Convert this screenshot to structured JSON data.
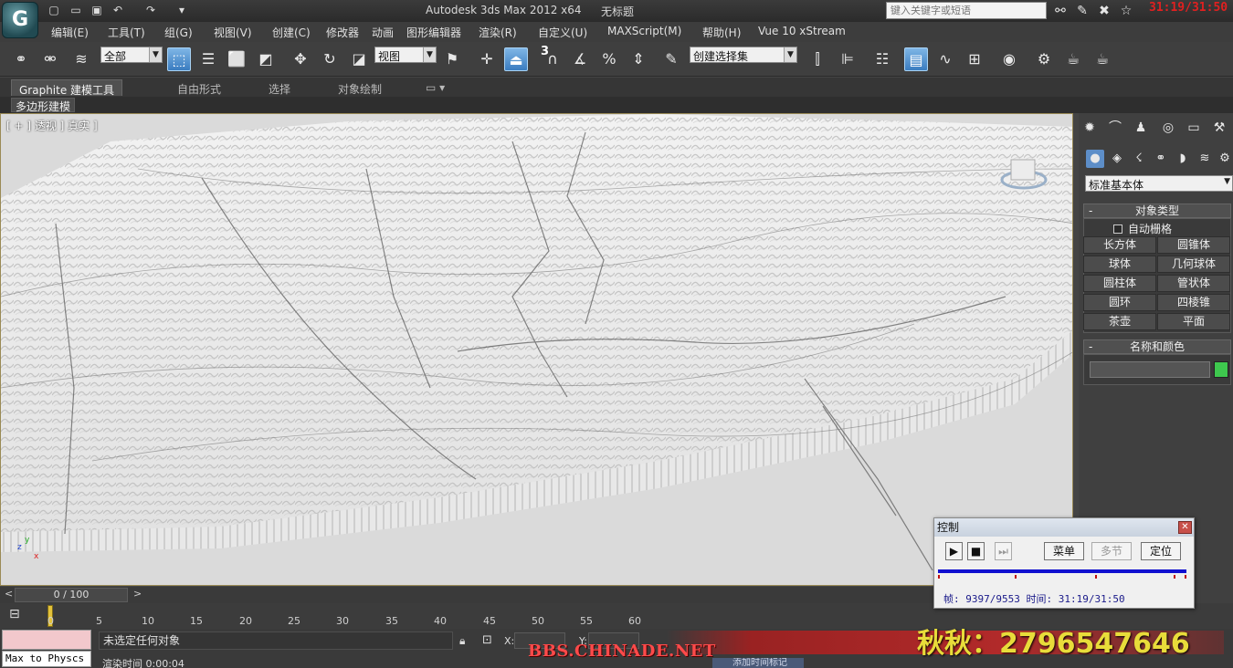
{
  "window": {
    "title": "Autodesk 3ds Max  2012 x64",
    "document": "无标题",
    "search_placeholder": "键入关键字或短语",
    "clock": "31:19/31:50"
  },
  "menu": [
    "编辑(E)",
    "工具(T)",
    "组(G)",
    "视图(V)",
    "创建(C)",
    "修改器",
    "动画",
    "图形编辑器",
    "渲染(R)",
    "自定义(U)",
    "MAXScript(M)",
    "帮助(H)",
    "Vue 10 xStream"
  ],
  "toolbar": {
    "filter": "全部",
    "coord": "视图",
    "selection_set": "创建选择集",
    "snap_num": "3",
    "percent_sym": "%"
  },
  "ribbon": {
    "tabs": [
      "Graphite 建模工具",
      "自由形式",
      "选择",
      "对象绘制"
    ],
    "subtab": "多边形建模"
  },
  "viewport": {
    "label": "[ + ] 透视 ] 真实 ]"
  },
  "command_panel": {
    "category": "标准基本体",
    "object_type_title": "对象类型",
    "autogrid": "自动栅格",
    "objects": [
      "长方体",
      "圆锥体",
      "球体",
      "几何球体",
      "圆柱体",
      "管状体",
      "圆环",
      "四棱锥",
      "茶壶",
      "平面"
    ],
    "name_color_title": "名称和颜色",
    "object_color": "#3ec84e"
  },
  "timeslider": {
    "counter": "0 / 100",
    "prev": "<",
    "next": ">"
  },
  "trackbar": {
    "ticks": [
      "0",
      "5",
      "10",
      "15",
      "20",
      "25",
      "30",
      "35",
      "40",
      "45",
      "50",
      "55",
      "60"
    ]
  },
  "status": {
    "maxscript_text": "Max to Physcs (",
    "prompt": "未选定任何对象",
    "render_time": "渲染时间  0:00:04",
    "x_label": "X:",
    "y_label": "Y:",
    "task_button": "添加时间标记"
  },
  "watermarks": {
    "left": "BBS.CHINADE.NET",
    "right": "秋秋：2796547646"
  },
  "control_window": {
    "title": "控制",
    "menu": "菜单",
    "multi": "多节",
    "locate": "定位",
    "frame_label": "帧:",
    "frame": "9397/9553",
    "time_label": "时间:",
    "time": "31:19/31:50"
  }
}
